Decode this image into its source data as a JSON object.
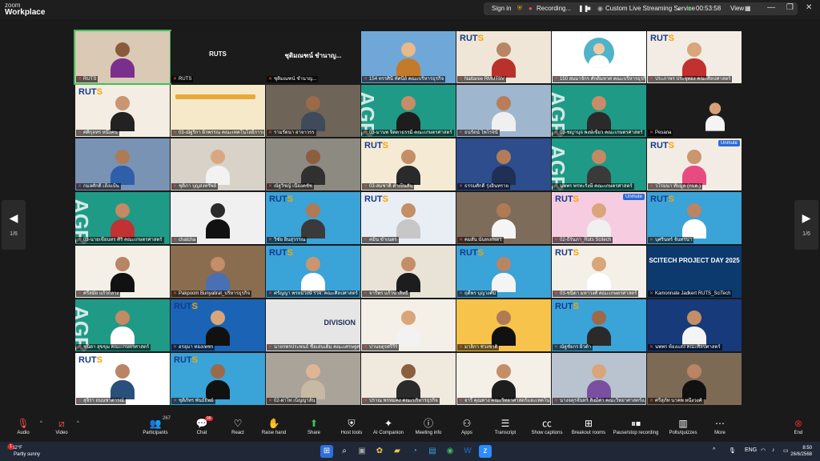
{
  "app": {
    "brand_line1": "zoom",
    "brand_line2": "Workplace"
  },
  "titlebar": {
    "signin": "Sign in",
    "recording": "Recording...",
    "streaming": "Custom Live Streaming Service",
    "timer": "00:53:58",
    "view": "View"
  },
  "nav": {
    "prev_page": "1/6",
    "next_page": "1/6"
  },
  "tiles": [
    {
      "label": "RUTS",
      "bg": "#d9c9b5",
      "kind": "person",
      "skin": "#8a5a3c",
      "shirt": "#7b2f8c",
      "active": true
    },
    {
      "label": "RUTS",
      "bg": "#1b1b1b",
      "kind": "name",
      "big": "RUTS"
    },
    {
      "label": "ชุติมณฑน์ ชำนาญ...",
      "bg": "#1b1b1b",
      "kind": "name",
      "big": "ชุติมณฑน์ ชำนาญ..."
    },
    {
      "label": "154 ทรรศินี ทัศนีย์ คณะบริหารธุรกิจ",
      "bg": "#6fa8d8",
      "kind": "person",
      "skin": "#e8b98a",
      "shirt": "#c47a2b"
    },
    {
      "label": "Nattaree RMUTSV",
      "bg": "#efe6d8",
      "kind": "logo",
      "skin": "#b98565",
      "shirt": "#b8322b"
    },
    {
      "label": "150 สมมาจักร ศักดิ์มหาศ คณะบริหารธุรกิจ",
      "bg": "#ffffff",
      "kind": "avatar"
    },
    {
      "label": "ประภาพร ประจุทอง คณะศิลปศาสตร์",
      "bg": "#f2ece4",
      "kind": "logo",
      "skin": "#d9a57a",
      "shirt": "#c0312f"
    },
    {
      "label": "ศศิกุลทร หนึ่งคน",
      "bg": "#f3ede4",
      "kind": "logo",
      "skin": "#c99670",
      "shirt": "#222222"
    },
    {
      "label": "03-ณัฐริกา ผิวพรรณ คณะเทคโนโลยีการเกษตร",
      "bg": "#f5e9c9",
      "kind": "banner"
    },
    {
      "label": "รามรัตนา อาจาวรร",
      "bg": "#6e6458",
      "kind": "person",
      "skin": "#9c6a48",
      "shirt": "#3f4a5c"
    },
    {
      "label": "03-มานพ จิตตาธรรมี คณะเกษตรศาสตร์",
      "bg": "#1f9a86",
      "kind": "agr",
      "skin": "#c98c68",
      "shirt": "#1d1d1d"
    },
    {
      "label": "ธนรัตน์ ไพโรจน์",
      "bg": "#9fb6cf",
      "kind": "person",
      "skin": "#b97d5a",
      "shirt": "#f0f0f0"
    },
    {
      "label": "03-ชญานุจ พงษ์เขียว คณะเกษตรศาสตร์",
      "bg": "#1f9a86",
      "kind": "agr",
      "skin": "#c98c68",
      "shirt": "#2a2a2a"
    },
    {
      "label": "Pesana",
      "bg": "#1b1b1b",
      "kind": "small",
      "skin": "#d6a07a",
      "shirt": "#f4f4f4"
    },
    {
      "label": "กมลศักดิ์ เส้งแป้น",
      "bg": "#7993b5",
      "kind": "person",
      "skin": "#b07a55",
      "shirt": "#2f5fa8"
    },
    {
      "label": "ชุติภา บุญสงทรัพย์",
      "bg": "#d8d2c9",
      "kind": "person",
      "skin": "#d9a883",
      "shirt": "#f2f2f2"
    },
    {
      "label": "ณัฐวิชญ์ เนื่องคชัช",
      "bg": "#8d8a82",
      "kind": "person",
      "skin": "#8c5e40",
      "shirt": "#303030"
    },
    {
      "label": "03-สมชาติ คำเป็นสัน",
      "bg": "#f5ead4",
      "kind": "banner2",
      "skin": "#c48e66",
      "shirt": "#2a2a2a"
    },
    {
      "label": "ธรรมศักดิ์ รุ่งอินทราย",
      "bg": "#2d4d8c",
      "kind": "person",
      "skin": "#b47b58",
      "shirt": "#1f2f55"
    },
    {
      "label": "นพพร พรทะรังษี คณะเกษตรศาสตร์",
      "bg": "#1f9a86",
      "kind": "agr",
      "skin": "#c48a64",
      "shirt": "#3a3a3a"
    },
    {
      "label": "วโรมนา ทับมูล (กบต.)",
      "bg": "#f2ece4",
      "kind": "logo",
      "skin": "#c99670",
      "shirt": "#e84b82",
      "unmute": "Unmute"
    },
    {
      "label": "03-นายเขียนทร ศิริ คณะเกษตรศาสตร์",
      "bg": "#1f9a86",
      "kind": "agr",
      "skin": "#c48a64",
      "shirt": "#c23232"
    },
    {
      "label": "chatcha",
      "bg": "#f0f0f0",
      "kind": "person",
      "skin": "#2a2a2a",
      "shirt": "#111111"
    },
    {
      "label": "วิชัย อินสุวรรณ",
      "bg": "#3aa3d8",
      "kind": "logo",
      "skin": "#b07a55",
      "shirt": "#3a3a3a"
    },
    {
      "label": "คมิน ขำเนตร",
      "bg": "#e9eef5",
      "kind": "office",
      "skin": "#c48e66",
      "shirt": "#c7c7c7"
    },
    {
      "label": "คมสัน นันทเทพตร",
      "bg": "#7d6c5a",
      "kind": "person",
      "skin": "#b07a55",
      "shirt": "#f5f5f5"
    },
    {
      "label": "02-ธีร์นภา_Ruts Scitech",
      "bg": "#f6cde0",
      "kind": "logo",
      "skin": "#d9a57a",
      "shirt": "#f0f0f0",
      "unmute": "Unmute"
    },
    {
      "label": "บุศรินทร์ จันทรนา",
      "bg": "#3aa3d8",
      "kind": "logo",
      "skin": "#b98565",
      "shirt": "#ffffff"
    },
    {
      "label": "ศรีสมัย แก้วกลาง",
      "bg": "#f4f0e8",
      "kind": "person",
      "skin": "#b98565",
      "shirt": "#111111"
    },
    {
      "label": "Pakpoom Bunyatirat_บริหารธุรกิจ",
      "bg": "#8a6d4e",
      "kind": "person",
      "skin": "#c48e66",
      "shirt": "#4a6fb5"
    },
    {
      "label": "ศรัญญา พรหมวงษ์ รวจ. คณะศิลปศาสตร์",
      "bg": "#3aa3d8",
      "kind": "logo",
      "skin": "#c99670",
      "shirt": "#ffffff"
    },
    {
      "label": "จารีพร แก้วนาสิทธิ์",
      "bg": "#e9e2d6",
      "kind": "person",
      "skin": "#c48e66",
      "shirt": "#1d1d1d"
    },
    {
      "label": "ฤดีพร บุญวงศ์ม",
      "bg": "#3aa3d8",
      "kind": "logo",
      "skin": "#b98565",
      "shirt": "#f4f4f4"
    },
    {
      "label": "03-ชนิดา มหาวงศ์ คณะเกษตรศาสตร์",
      "bg": "#f4f0e8",
      "kind": "logo",
      "skin": "#d9a57a",
      "shirt": "#ffffff"
    },
    {
      "label": "Kamonnate Jadkert RUTS_SciTech",
      "bg": "#0c3a6e",
      "kind": "scitech",
      "big": "SCITECH PROJECT DAY 2025"
    },
    {
      "label": "ชนิดา สุขขุม คณะเกษตรศาสตร์",
      "bg": "#1f9a86",
      "kind": "agr",
      "skin": "#c48a64",
      "shirt": "#ffffff"
    },
    {
      "label": "อรอุมา ทองเพชร",
      "bg": "#1b64b5",
      "kind": "logo",
      "skin": "#d9a57a",
      "shirt": "#111111"
    },
    {
      "label": "นายรพรประพนธ์ ชื่อเล่นเดิม คณะเศรษฐศาสตร์",
      "bg": "#e6e6e6",
      "kind": "division",
      "big": "DIVISION"
    },
    {
      "label": "ปานจตุรศรีรีร์",
      "bg": "#f4f0e8",
      "kind": "person",
      "skin": "#d9a57a",
      "shirt": "#f2f2f2"
    },
    {
      "label": "มาลิกา ช่วงชาติ",
      "bg": "#f7c34a",
      "kind": "person",
      "skin": "#b07a55",
      "shirt": "#111111"
    },
    {
      "label": "ณัฐชัยกร ผิวดำ",
      "bg": "#3aa3d8",
      "kind": "logo",
      "skin": "#9c6a48",
      "shirt": "#2a2a2a"
    },
    {
      "label": "นพพร ท้องแสง คณะศิลปศาสตร์",
      "bg": "#163a7a",
      "kind": "person",
      "skin": "#c48e66",
      "shirt": "#f4f4f4"
    },
    {
      "label": "สุจิรา ถนนชาตารณ์",
      "bg": "#ffffff",
      "kind": "hr",
      "skin": "#b98565",
      "shirt": "#2a4f7a"
    },
    {
      "label": "ชุติภัทร พันธ์ธิพย์",
      "bg": "#3aa3d8",
      "kind": "logo",
      "skin": "#9c6a48",
      "shirt": "#111111"
    },
    {
      "label": "02-ผ่าไท เบ็ญญาลัน",
      "bg": "#a9a39a",
      "kind": "person",
      "skin": "#e0b593",
      "shirt": "#c7b9a4"
    },
    {
      "label": "ปราณ พรหมคง คณะบริหารธุรกิจ",
      "bg": "#efe9de",
      "kind": "person",
      "skin": "#8c5e40",
      "shirt": "#2a2a2a"
    },
    {
      "label": "จารี คุณทาง คณะวิทยาศาสตร์และเทคโนโลยี",
      "bg": "#f4f0e8",
      "kind": "person",
      "skin": "#c48e66",
      "shirt": "#1d1d1d"
    },
    {
      "label": "นางจตุรจันทร์ สิ่งมีค่า คณะวิทยาศาสตร์และเทคโนโลยี",
      "bg": "#b9c3cf",
      "kind": "person",
      "skin": "#d9a57a",
      "shirt": "#7a4fa0"
    },
    {
      "label": "ศรีสุภัท นาคพ หนึ่งวงศ์",
      "bg": "#7d6a55",
      "kind": "person",
      "skin": "#b98565",
      "shirt": "#111111"
    }
  ],
  "toolbar": {
    "audio": "Audio",
    "video": "Video",
    "participants": "Participants",
    "participants_count": "267",
    "chat": "Chat",
    "chat_badge": "99",
    "react": "React",
    "raise_hand": "Raise hand",
    "share": "Share",
    "host_tools": "Host tools",
    "ai_companion": "AI Companion",
    "meeting_info": "Meeting info",
    "apps": "Apps",
    "transcript": "Transcript",
    "show_captions": "Show captions",
    "breakout_rooms": "Breakout rooms",
    "pause_stop_recording": "Pause/stop recording",
    "polls_quizzes": "Polls/quizzes",
    "more": "More",
    "end": "End"
  },
  "taskbar": {
    "temperature": "82°F",
    "weather": "Partly sunny",
    "weather_badge": "1",
    "language": "ENG",
    "time": "8:50",
    "date": "26/6/2568"
  },
  "colors": {
    "active_border": "#3fbf5a",
    "end_red": "#e02828",
    "ruts_blue": "#173a8a",
    "ruts_orange": "#f7a400"
  }
}
